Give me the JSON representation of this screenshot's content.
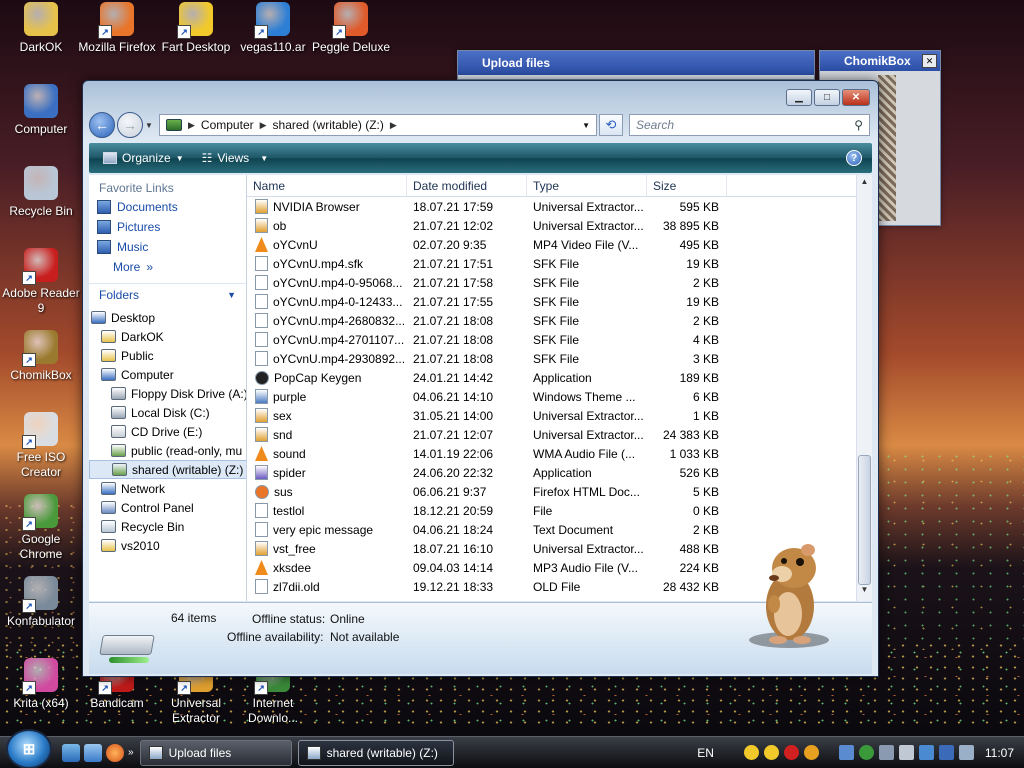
{
  "desktop": {
    "icons": [
      {
        "label": "DarkOK",
        "icon": "folder-zip-icon",
        "color": "#e7c24a"
      },
      {
        "label": "Mozilla Firefox",
        "icon": "firefox-icon",
        "color": "#e8752a"
      },
      {
        "label": "Fart Desktop",
        "icon": "smiley-icon",
        "color": "#f2c92a"
      },
      {
        "label": "vegas110.ar",
        "icon": "vegas-icon",
        "color": "#2d7fd6"
      },
      {
        "label": "Peggle Deluxe",
        "icon": "peggle-icon",
        "color": "#e05a2a"
      },
      {
        "label": "Computer",
        "icon": "computer-icon",
        "color": "#3a6fc2"
      },
      {
        "label": "Recycle Bin",
        "icon": "recycle-bin-icon",
        "color": "#b8c6d6"
      },
      {
        "label": "Adobe Reader 9",
        "icon": "adobe-reader-icon",
        "color": "#c81e1e"
      },
      {
        "label": "ChomikBox",
        "icon": "chomikbox-icon",
        "color": "#9a7a2e"
      },
      {
        "label": "Free ISO Creator",
        "icon": "iso-creator-icon",
        "color": "#d9dde2"
      },
      {
        "label": "Google Chrome",
        "icon": "chrome-icon",
        "color": "#4a9a3c"
      },
      {
        "label": "Konfabulator",
        "icon": "konfabulator-icon",
        "color": "#7a8a9a"
      },
      {
        "label": "Krita (x64)",
        "icon": "krita-icon",
        "color": "#d04aa0"
      },
      {
        "label": "Bandicam",
        "icon": "bandicam-icon",
        "color": "#c01a1a"
      },
      {
        "label": "Universal Extractor",
        "icon": "extractor-icon",
        "color": "#e0a030"
      },
      {
        "label": "Internet Downlo...",
        "icon": "idm-icon",
        "color": "#3a8a3a"
      }
    ]
  },
  "back_windows": {
    "upload_title": "Upload files",
    "chomik_title": "ChomikBox",
    "chomik_close": "✕"
  },
  "explorer": {
    "breadcrumb": [
      "Computer",
      "shared (writable) (Z:)"
    ],
    "search_placeholder": "Search",
    "toolbar": {
      "organize": "Organize",
      "views": "Views",
      "help": "?"
    },
    "favorite_links_header": "Favorite Links",
    "favorite_links": [
      "Documents",
      "Pictures",
      "Music"
    ],
    "more": "More",
    "folders_header": "Folders",
    "tree": [
      {
        "label": "Desktop",
        "indent": 0,
        "color": "#3a6fc2"
      },
      {
        "label": "DarkOK",
        "indent": 1,
        "color": "#e7c24a"
      },
      {
        "label": "Public",
        "indent": 1,
        "color": "#e7c24a"
      },
      {
        "label": "Computer",
        "indent": 1,
        "color": "#3a6fc2"
      },
      {
        "label": "Floppy Disk Drive (A:)",
        "indent": 2,
        "color": "#9aa6b4"
      },
      {
        "label": "Local Disk (C:)",
        "indent": 2,
        "color": "#9aa6b4"
      },
      {
        "label": "CD Drive (E:)",
        "indent": 2,
        "color": "#c7ced6"
      },
      {
        "label": "public (read-only, mu",
        "indent": 2,
        "color": "#6aa04c"
      },
      {
        "label": "shared (writable) (Z:)",
        "indent": 2,
        "color": "#6aa04c",
        "selected": true
      },
      {
        "label": "Network",
        "indent": 1,
        "color": "#3a6fc2"
      },
      {
        "label": "Control Panel",
        "indent": 1,
        "color": "#6a8ac2"
      },
      {
        "label": "Recycle Bin",
        "indent": 1,
        "color": "#b8c6d6"
      },
      {
        "label": "vs2010",
        "indent": 1,
        "color": "#e7c24a"
      }
    ],
    "columns": [
      "Name",
      "Date modified",
      "Type",
      "Size"
    ],
    "files": [
      {
        "name": "NVIDIA Browser",
        "date": "18.07.21 17:59",
        "type": "Universal Extractor...",
        "size": "595 KB",
        "icon": "extractor-file-icon",
        "color": "#e0a030"
      },
      {
        "name": "ob",
        "date": "21.07.21 12:02",
        "type": "Universal Extractor...",
        "size": "38 895 KB",
        "icon": "extractor-file-icon",
        "color": "#e0a030"
      },
      {
        "name": "oYCvnU",
        "date": "02.07.20 9:35",
        "type": "MP4 Video File (V...",
        "size": "495 KB",
        "icon": "vlc-cone-icon",
        "color": "#f08a1a"
      },
      {
        "name": "oYCvnU.mp4.sfk",
        "date": "21.07.21 17:51",
        "type": "SFK File",
        "size": "19 KB",
        "icon": "blank-file-icon",
        "color": "#ffffff"
      },
      {
        "name": "oYCvnU.mp4-0-95068...",
        "date": "21.07.21 17:58",
        "type": "SFK File",
        "size": "2 KB",
        "icon": "blank-file-icon",
        "color": "#ffffff"
      },
      {
        "name": "oYCvnU.mp4-0-12433...",
        "date": "21.07.21 17:55",
        "type": "SFK File",
        "size": "19 KB",
        "icon": "blank-file-icon",
        "color": "#ffffff"
      },
      {
        "name": "oYCvnU.mp4-2680832...",
        "date": "21.07.21 18:08",
        "type": "SFK File",
        "size": "2 KB",
        "icon": "blank-file-icon",
        "color": "#ffffff"
      },
      {
        "name": "oYCvnU.mp4-2701107...",
        "date": "21.07.21 18:08",
        "type": "SFK File",
        "size": "4 KB",
        "icon": "blank-file-icon",
        "color": "#ffffff"
      },
      {
        "name": "oYCvnU.mp4-2930892...",
        "date": "21.07.21 18:08",
        "type": "SFK File",
        "size": "3 KB",
        "icon": "blank-file-icon",
        "color": "#ffffff"
      },
      {
        "name": "PopCap Keygen",
        "date": "24.01.21 14:42",
        "type": "Application",
        "size": "189 KB",
        "icon": "keygen-icon",
        "color": "#222222"
      },
      {
        "name": "purple",
        "date": "04.06.21 14:10",
        "type": "Windows Theme ...",
        "size": "6 KB",
        "icon": "theme-file-icon",
        "color": "#4a7ac2"
      },
      {
        "name": "sex",
        "date": "31.05.21 14:00",
        "type": "Universal Extractor...",
        "size": "1 KB",
        "icon": "extractor-file-icon",
        "color": "#e0a030"
      },
      {
        "name": "snd",
        "date": "21.07.21 12:07",
        "type": "Universal Extractor...",
        "size": "24 383 KB",
        "icon": "extractor-file-icon",
        "color": "#e0a030"
      },
      {
        "name": "sound",
        "date": "14.01.19 22:06",
        "type": "WMA Audio File (...",
        "size": "1 033 KB",
        "icon": "vlc-cone-icon",
        "color": "#f08a1a"
      },
      {
        "name": "spider",
        "date": "24.06.20 22:32",
        "type": "Application",
        "size": "526 KB",
        "icon": "spider-app-icon",
        "color": "#6a5ac2"
      },
      {
        "name": "sus",
        "date": "06.06.21 9:37",
        "type": "Firefox HTML Doc...",
        "size": "5 KB",
        "icon": "firefox-doc-icon",
        "color": "#e8752a"
      },
      {
        "name": "testlol",
        "date": "18.12.21 20:59",
        "type": "File",
        "size": "0 KB",
        "icon": "blank-file-icon",
        "color": "#ffffff"
      },
      {
        "name": "very epic message",
        "date": "04.06.21 18:24",
        "type": "Text Document",
        "size": "2 KB",
        "icon": "text-file-icon",
        "color": "#ffffff"
      },
      {
        "name": "vst_free",
        "date": "18.07.21 16:10",
        "type": "Universal Extractor...",
        "size": "488 KB",
        "icon": "extractor-file-icon",
        "color": "#e0a030"
      },
      {
        "name": "xksdee",
        "date": "09.04.03 14:14",
        "type": "MP3 Audio File (V...",
        "size": "224 KB",
        "icon": "vlc-cone-icon",
        "color": "#f08a1a"
      },
      {
        "name": "zl7dii.old",
        "date": "19.12.21 18:33",
        "type": "OLD File",
        "size": "28 432 KB",
        "icon": "blank-file-icon",
        "color": "#ffffff"
      }
    ],
    "details": {
      "count": "64 items",
      "offline_status_label": "Offline status:",
      "offline_status_value": "Online",
      "offline_avail_label": "Offline availability:",
      "offline_avail_value": "Not available"
    }
  },
  "taskbar": {
    "start": "⊞",
    "buttons": [
      {
        "label": "Upload files",
        "active": false
      },
      {
        "label": "shared (writable) (Z:)",
        "active": true
      }
    ],
    "lang": "EN",
    "clock": "11:07"
  }
}
